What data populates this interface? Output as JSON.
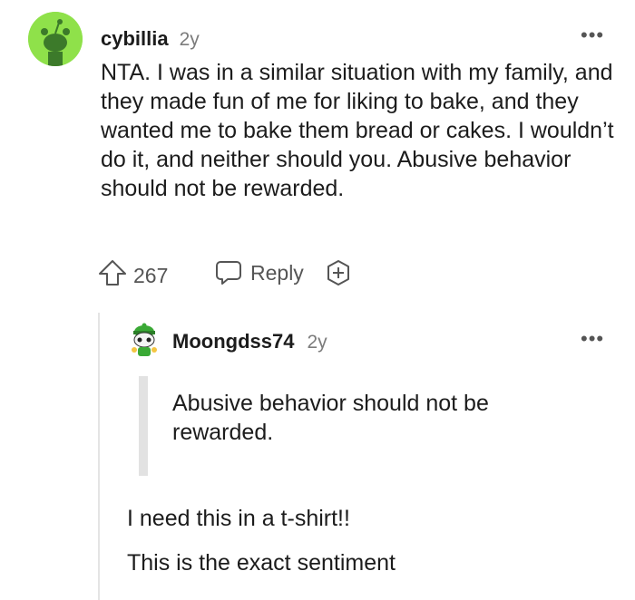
{
  "comment": {
    "username": "cybillia",
    "age": "2y",
    "more_label": "•••",
    "body": "NTA. I was in a similar situation with my family, and they made fun of me for liking to bake, and they wanted me to bake them bread or cakes. I wouldn’t do it, and neither should you. Abusive behavior should not be rewarded.",
    "votes": "267",
    "reply_label": "Reply"
  },
  "reply": {
    "username": "Moongdss74",
    "age": "2y",
    "more_label": "•••",
    "quote": "Abusive behavior should not be rewarded.",
    "paragraphs": [
      "I need this in a t-shirt!!",
      "This is the exact sentiment"
    ]
  },
  "colors": {
    "avatar_green": "#8fe14a",
    "text": "#1c1c1c",
    "muted": "#7c7c7c"
  },
  "icons": {
    "upvote": "upvote-arrow-icon",
    "reply": "speech-bubble-icon",
    "award": "plus-award-icon",
    "more": "ellipsis-icon"
  }
}
